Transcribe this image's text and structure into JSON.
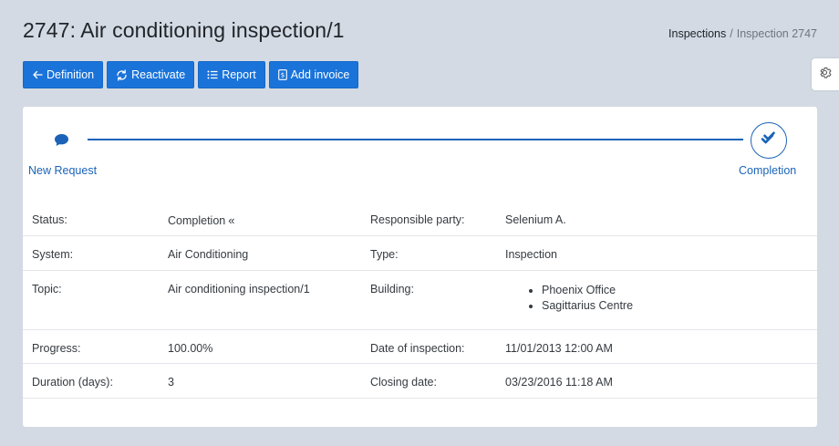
{
  "header": {
    "title": "2747: Air conditioning inspection/1",
    "breadcrumb": {
      "parent": "Inspections",
      "separator": "/",
      "current": "Inspection 2747"
    }
  },
  "toolbar": {
    "definition_label": "Definition",
    "reactivate_label": "Reactivate",
    "report_label": "Report",
    "add_invoice_label": "Add invoice"
  },
  "workflow": {
    "start_label": "New Request",
    "end_label": "Completion"
  },
  "details": {
    "status_label": "Status:",
    "status_value": "Completion",
    "responsible_label": "Responsible party:",
    "responsible_value": "Selenium A.",
    "system_label": "System:",
    "system_value": "Air Conditioning",
    "type_label": "Type:",
    "type_value": "Inspection",
    "topic_label": "Topic:",
    "topic_value": "Air conditioning inspection/1",
    "building_label": "Building:",
    "buildings": [
      "Phoenix Office",
      "Sagittarius Centre"
    ],
    "progress_label": "Progress:",
    "progress_value": "100.00%",
    "inspection_date_label": "Date of inspection:",
    "inspection_date_value": "11/01/2013 12:00 AM",
    "duration_label": "Duration (days):",
    "duration_value": "3",
    "closing_date_label": "Closing date:",
    "closing_date_value": "03/23/2016 11:18 AM"
  },
  "colors": {
    "page_bg": "#d3dae4",
    "button_bg": "#1a73d9",
    "accent": "#1a63b8"
  },
  "icons": {
    "definition": "arrow-left-icon",
    "reactivate": "refresh-icon",
    "report": "list-icon",
    "add_invoice": "invoice-icon",
    "settings": "gear-icon",
    "start_step": "chat-bubble-icon",
    "end_step": "double-check-icon",
    "status_action": "rewind-icon"
  }
}
